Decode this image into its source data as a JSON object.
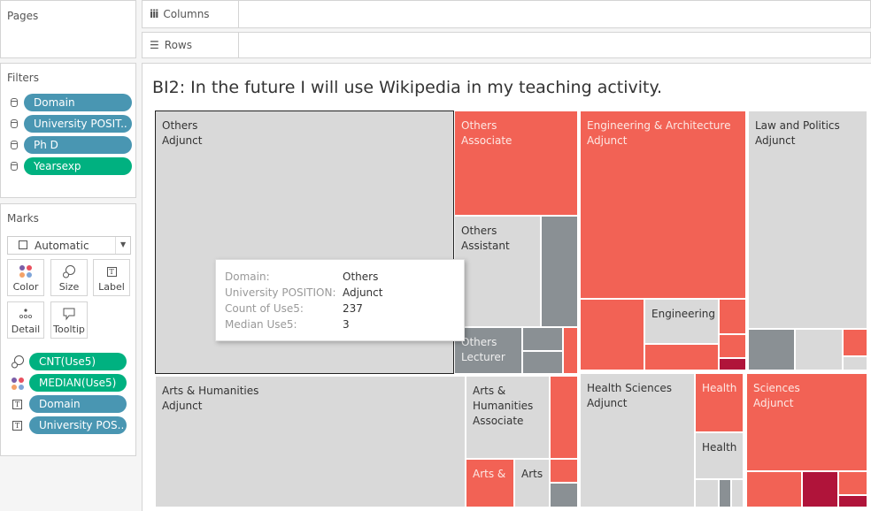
{
  "pages_panel": {
    "title": "Pages"
  },
  "shelves": {
    "columns_label": "Columns",
    "rows_label": "Rows"
  },
  "filters": {
    "title": "Filters",
    "items": [
      {
        "label": "Domain",
        "type": "dimension",
        "color": "#4996b2"
      },
      {
        "label": "University POSIT..",
        "type": "dimension",
        "color": "#4996b2"
      },
      {
        "label": "Ph D",
        "type": "dimension",
        "color": "#4996b2"
      },
      {
        "label": "Yearsexp",
        "type": "measure",
        "color": "#00b180"
      }
    ]
  },
  "marks": {
    "title": "Marks",
    "mark_type": "Automatic",
    "buttons": [
      {
        "label": "Color",
        "icon": "color-dots-icon"
      },
      {
        "label": "Size",
        "icon": "size-icon"
      },
      {
        "label": "Label",
        "icon": "text-label-icon"
      },
      {
        "label": "Detail",
        "icon": "detail-icon"
      },
      {
        "label": "Tooltip",
        "icon": "tooltip-icon"
      }
    ],
    "fields": [
      {
        "label": "CNT(Use5)",
        "encoding": "size",
        "color": "#00b180"
      },
      {
        "label": "MEDIAN(Use5)",
        "encoding": "color",
        "color": "#00b180"
      },
      {
        "label": "Domain",
        "encoding": "label",
        "color": "#4996b2"
      },
      {
        "label": "University POS..",
        "encoding": "label",
        "color": "#4996b2"
      }
    ]
  },
  "viz": {
    "title": "BI2: In the future I will use Wikipedia in my teaching activity.",
    "colors": {
      "high": "#f26255",
      "mid": "#d9d9d9",
      "low": "#8a9094",
      "highest": "#b0143a"
    },
    "tiles": {
      "others_adjunct": [
        "Others",
        "Adjunct"
      ],
      "others_associate": [
        "Others",
        "Associate"
      ],
      "others_assistant": [
        "Others",
        "Assistant"
      ],
      "others_lecturer": [
        "Others",
        "Lecturer"
      ],
      "eng_adjunct": [
        "Engineering & Architecture",
        "Adjunct"
      ],
      "eng_small": [
        "Engineering"
      ],
      "law_adjunct": [
        "Law and Politics",
        "Adjunct"
      ],
      "arts_adjunct": [
        "Arts & Humanities",
        "Adjunct"
      ],
      "arts_associate": [
        "Arts &",
        "Humanities",
        "Associate"
      ],
      "arts_small1": [
        "Arts &"
      ],
      "arts_small2": [
        "Arts"
      ],
      "health_adjunct": [
        "Health Sciences",
        "Adjunct"
      ],
      "health_small1": [
        "Health"
      ],
      "health_small2": [
        "Health"
      ],
      "sciences_adjunct": [
        "Sciences",
        "Adjunct"
      ]
    }
  },
  "tooltip": {
    "rows": [
      {
        "key": "Domain:",
        "value": "Others"
      },
      {
        "key": "University POSITION:",
        "value": "Adjunct"
      },
      {
        "key": "Count of Use5:",
        "value": "237"
      },
      {
        "key": "Median Use5:",
        "value": "3"
      }
    ]
  }
}
